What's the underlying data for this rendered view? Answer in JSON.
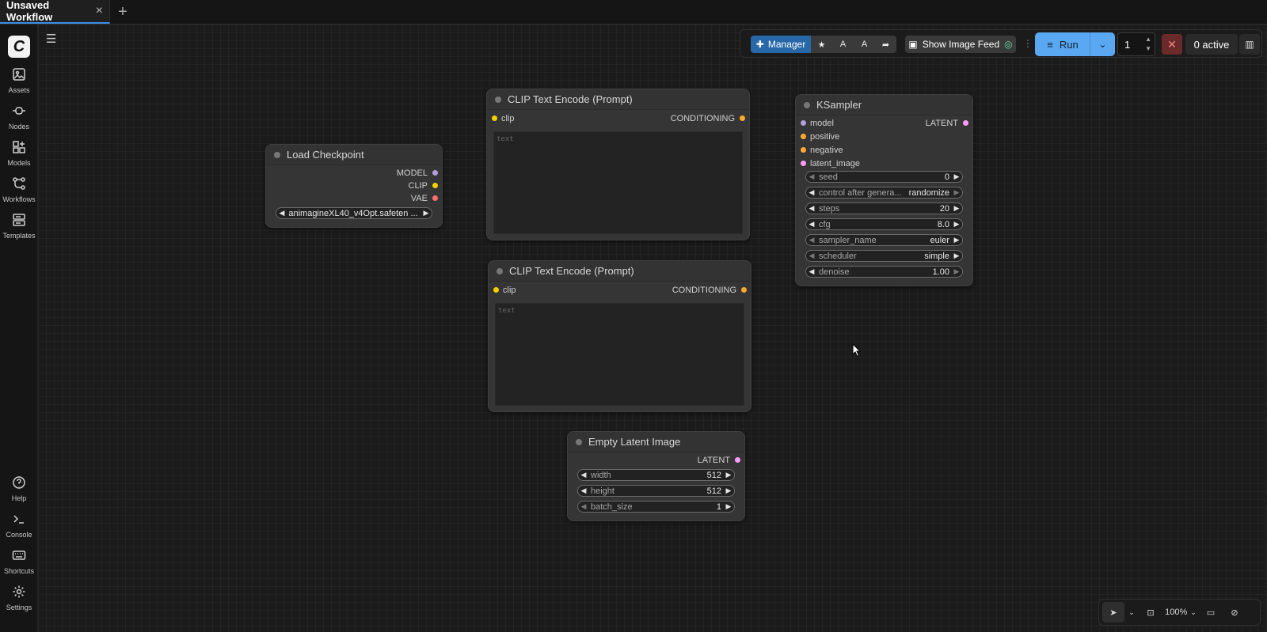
{
  "tabs": {
    "active": "Unsaved Workflow",
    "close_icon": "×",
    "add_icon": "+"
  },
  "sidebar": {
    "logo": "C",
    "items": [
      {
        "label": "Assets",
        "icon": "image-icon"
      },
      {
        "label": "Nodes",
        "icon": "node-icon"
      },
      {
        "label": "Models",
        "icon": "models-icon"
      },
      {
        "label": "Workflows",
        "icon": "workflow-icon"
      },
      {
        "label": "Templates",
        "icon": "template-icon"
      },
      {
        "label": "Help",
        "icon": "help-icon"
      },
      {
        "label": "Console",
        "icon": "console-icon"
      },
      {
        "label": "Shortcuts",
        "icon": "keyboard-icon"
      },
      {
        "label": "Settings",
        "icon": "gear-icon"
      }
    ]
  },
  "toolbar": {
    "manager": "Manager",
    "show_feed": "Show Image Feed",
    "run": "Run",
    "queue_count": "1",
    "active": "0 active"
  },
  "nodes": {
    "load_checkpoint": {
      "title": "Load Checkpoint",
      "outputs": [
        "MODEL",
        "CLIP",
        "VAE"
      ],
      "ckpt_value": "animagineXL40_v4Opt.safeten ..."
    },
    "clip1": {
      "title": "CLIP Text Encode (Prompt)",
      "input": "clip",
      "output": "CONDITIONING",
      "placeholder": "text"
    },
    "clip2": {
      "title": "CLIP Text Encode (Prompt)",
      "input": "clip",
      "output": "CONDITIONING",
      "placeholder": "text"
    },
    "empty_latent": {
      "title": "Empty Latent Image",
      "output": "LATENT",
      "widgets": [
        {
          "name": "width",
          "value": "512"
        },
        {
          "name": "height",
          "value": "512"
        },
        {
          "name": "batch_size",
          "value": "1"
        }
      ]
    },
    "ksampler": {
      "title": "KSampler",
      "inputs": [
        "model",
        "positive",
        "negative",
        "latent_image"
      ],
      "output": "LATENT",
      "widgets": [
        {
          "name": "seed",
          "value": "0"
        },
        {
          "name": "control after genera...",
          "value": "randomize"
        },
        {
          "name": "steps",
          "value": "20"
        },
        {
          "name": "cfg",
          "value": "8.0"
        },
        {
          "name": "sampler_name",
          "value": "euler"
        },
        {
          "name": "scheduler",
          "value": "simple"
        },
        {
          "name": "denoise",
          "value": "1.00"
        }
      ]
    }
  },
  "bottom": {
    "zoom": "100%"
  },
  "colors": {
    "model": "#b39ddb",
    "clip": "#f5d000",
    "vae": "#ff6e6e",
    "conditioning": "#ffa931",
    "latent": "#ff9cf9",
    "accent": "#5aa7f2"
  }
}
